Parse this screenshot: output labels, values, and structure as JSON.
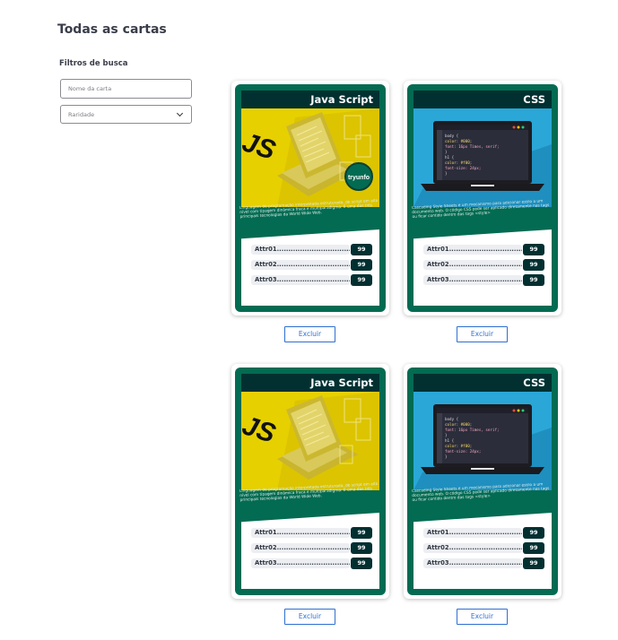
{
  "page": {
    "title": "Todas as cartas"
  },
  "filters": {
    "title": "Filtros de busca",
    "name_placeholder": "Nome da carta",
    "rarity_placeholder": "Raridade"
  },
  "cards": [
    {
      "name": "Java Script",
      "logo_text": "JS",
      "badge": "tryunfo",
      "description": "Linguagem de programação interpretada estruturada, de script em alto nível com tipagem dinâmica fraca e multiparadigma. É uma das três principais tecnologias da World Wide Web.",
      "attrs": [
        {
          "label": "Attr01......................................",
          "value": "99"
        },
        {
          "label": "Attr02......................................",
          "value": "99"
        },
        {
          "label": "Attr03......................................",
          "value": "99"
        }
      ],
      "delete_label": "Excluir"
    },
    {
      "name": "CSS",
      "description": "Cascading Style Sheets é um mecanismo para adicionar estilo a um documento web. O código CSS pode ser aplicado diretamente nas tags ou ficar contido dentro das tags <style>",
      "code": [
        "body {",
        "  color: #000;",
        "  font: 16px Times, serif;",
        "}",
        "h1 {",
        "  color: #f00;",
        "  font-size: 24px;",
        "}"
      ],
      "attrs": [
        {
          "label": "Attr01......................................",
          "value": "99"
        },
        {
          "label": "Attr02......................................",
          "value": "99"
        },
        {
          "label": "Attr03......................................",
          "value": "99"
        }
      ],
      "delete_label": "Excluir"
    },
    {
      "name": "Java Script",
      "logo_text": "JS",
      "description": "Linguagem de programação interpretada estruturada, de script em alto nível com tipagem dinâmica fraca e multiparadigma. É uma das três principais tecnologias da World Wide Web.",
      "attrs": [
        {
          "label": "Attr01......................................",
          "value": "99"
        },
        {
          "label": "Attr02......................................",
          "value": "99"
        },
        {
          "label": "Attr03......................................",
          "value": "99"
        }
      ],
      "delete_label": "Excluir"
    },
    {
      "name": "CSS",
      "description": "Cascading Style Sheets é um mecanismo para adicionar estilo a um documento web. O código CSS pode ser aplicado diretamente nas tags ou ficar contido dentro das tags <style>",
      "code": [
        "body {",
        "  color: #000;",
        "  font: 16px Times, serif;",
        "}",
        "h1 {",
        "  color: #f00;",
        "  font-size: 24px;",
        "}"
      ],
      "attrs": [
        {
          "label": "Attr01......................................",
          "value": "99"
        },
        {
          "label": "Attr02......................................",
          "value": "99"
        },
        {
          "label": "Attr03......................................",
          "value": "99"
        }
      ],
      "delete_label": "Excluir"
    }
  ],
  "colors": {
    "card_green": "#036b52",
    "card_dark": "#023031",
    "js_yellow": "#e6d000",
    "css_blue": "#2aa7d6",
    "button_blue": "#2f6fd0"
  }
}
